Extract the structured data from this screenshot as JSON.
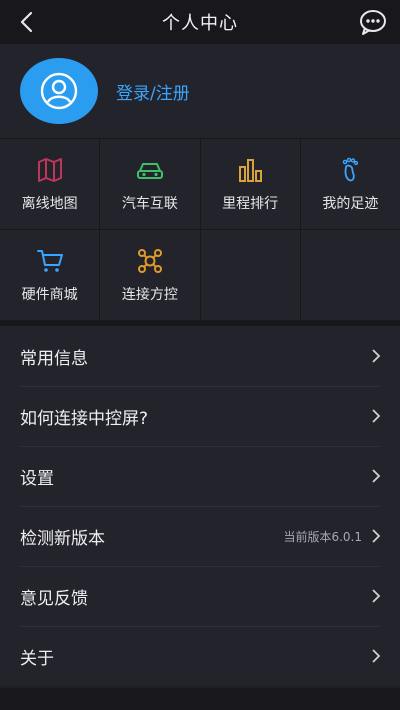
{
  "header": {
    "title": "个人中心"
  },
  "profile": {
    "login_label": "登录/注册"
  },
  "grid": {
    "items": [
      {
        "label": "离线地图",
        "icon": "map-icon",
        "color": "#c0355a"
      },
      {
        "label": "汽车互联",
        "icon": "car-icon",
        "color": "#3fbf6a"
      },
      {
        "label": "里程排行",
        "icon": "bar-chart-icon",
        "color": "#d9a23a"
      },
      {
        "label": "我的足迹",
        "icon": "footprint-icon",
        "color": "#3aa5ff"
      },
      {
        "label": "硬件商城",
        "icon": "cart-icon",
        "color": "#3aa5ff"
      },
      {
        "label": "连接方控",
        "icon": "controller-icon",
        "color": "#e09a2a"
      }
    ]
  },
  "menu": {
    "items": [
      {
        "label": "常用信息",
        "value": ""
      },
      {
        "label": "如何连接中控屏?",
        "value": ""
      },
      {
        "label": "设置",
        "value": ""
      },
      {
        "label": "检测新版本",
        "value": "当前版本6.0.1"
      },
      {
        "label": "意见反馈",
        "value": ""
      },
      {
        "label": "关于",
        "value": ""
      }
    ]
  },
  "colors": {
    "accent": "#2b9df0",
    "background": "#1f1f26",
    "panel": "#23232b"
  }
}
